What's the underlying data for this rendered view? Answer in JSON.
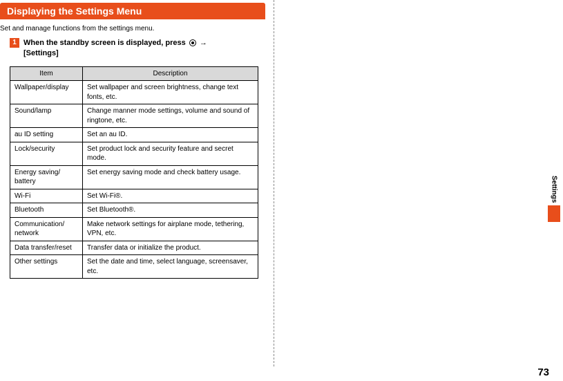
{
  "section_title": "Displaying the Settings Menu",
  "intro": "Set and manage functions from the settings menu.",
  "step": {
    "num": "1",
    "prefix": "When the standby screen is displayed, press ",
    "arrow": " → ",
    "suffix": "[Settings]"
  },
  "table": {
    "headers": {
      "item": "Item",
      "desc": "Description"
    },
    "rows": [
      {
        "item": "Wallpaper/display",
        "desc": "Set wallpaper and screen brightness, change text fonts, etc."
      },
      {
        "item": "Sound/lamp",
        "desc": "Change manner mode settings, volume and sound of ringtone, etc."
      },
      {
        "item": "au ID setting",
        "desc": "Set an au ID."
      },
      {
        "item": "Lock/security",
        "desc": "Set product lock and security feature and secret mode."
      },
      {
        "item": "Energy saving/\nbattery",
        "desc": "Set energy saving mode and check battery usage."
      },
      {
        "item": "Wi-Fi",
        "desc": "Set Wi-Fi®."
      },
      {
        "item": "Bluetooth",
        "desc": "Set Bluetooth®."
      },
      {
        "item": "Communication/\nnetwork",
        "desc": "Make network settings for airplane mode, tethering, VPN, etc."
      },
      {
        "item": "Data transfer/reset",
        "desc": "Transfer data or initialize the product."
      },
      {
        "item": "Other settings",
        "desc": "Set the date and time, select language, screensaver, etc."
      }
    ]
  },
  "side_tab": "Settings",
  "page_number": "73"
}
